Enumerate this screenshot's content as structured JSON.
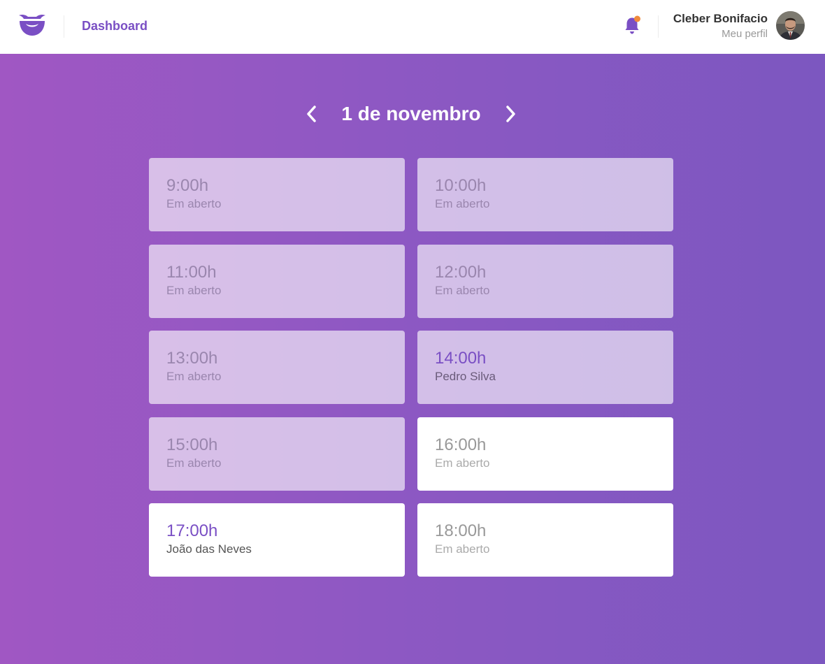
{
  "header": {
    "nav_label": "Dashboard",
    "user_name": "Cleber Bonifacio",
    "profile_link": "Meu perfil",
    "has_notification": true,
    "accent_color": "#7a4fc4",
    "notification_color": "#f08a3c"
  },
  "date_nav": {
    "title": "1 de novembro"
  },
  "slots": [
    {
      "time": "9:00h",
      "status": "Em aberto",
      "state": "past",
      "booked": false
    },
    {
      "time": "10:00h",
      "status": "Em aberto",
      "state": "past",
      "booked": false
    },
    {
      "time": "11:00h",
      "status": "Em aberto",
      "state": "past",
      "booked": false
    },
    {
      "time": "12:00h",
      "status": "Em aberto",
      "state": "past",
      "booked": false
    },
    {
      "time": "13:00h",
      "status": "Em aberto",
      "state": "past",
      "booked": false
    },
    {
      "time": "14:00h",
      "status": "Pedro Silva",
      "state": "past",
      "booked": true
    },
    {
      "time": "15:00h",
      "status": "Em aberto",
      "state": "past",
      "booked": false
    },
    {
      "time": "16:00h",
      "status": "Em aberto",
      "state": "future",
      "booked": false
    },
    {
      "time": "17:00h",
      "status": "João das Neves",
      "state": "future",
      "booked": true
    },
    {
      "time": "18:00h",
      "status": "Em aberto",
      "state": "future",
      "booked": false
    }
  ]
}
